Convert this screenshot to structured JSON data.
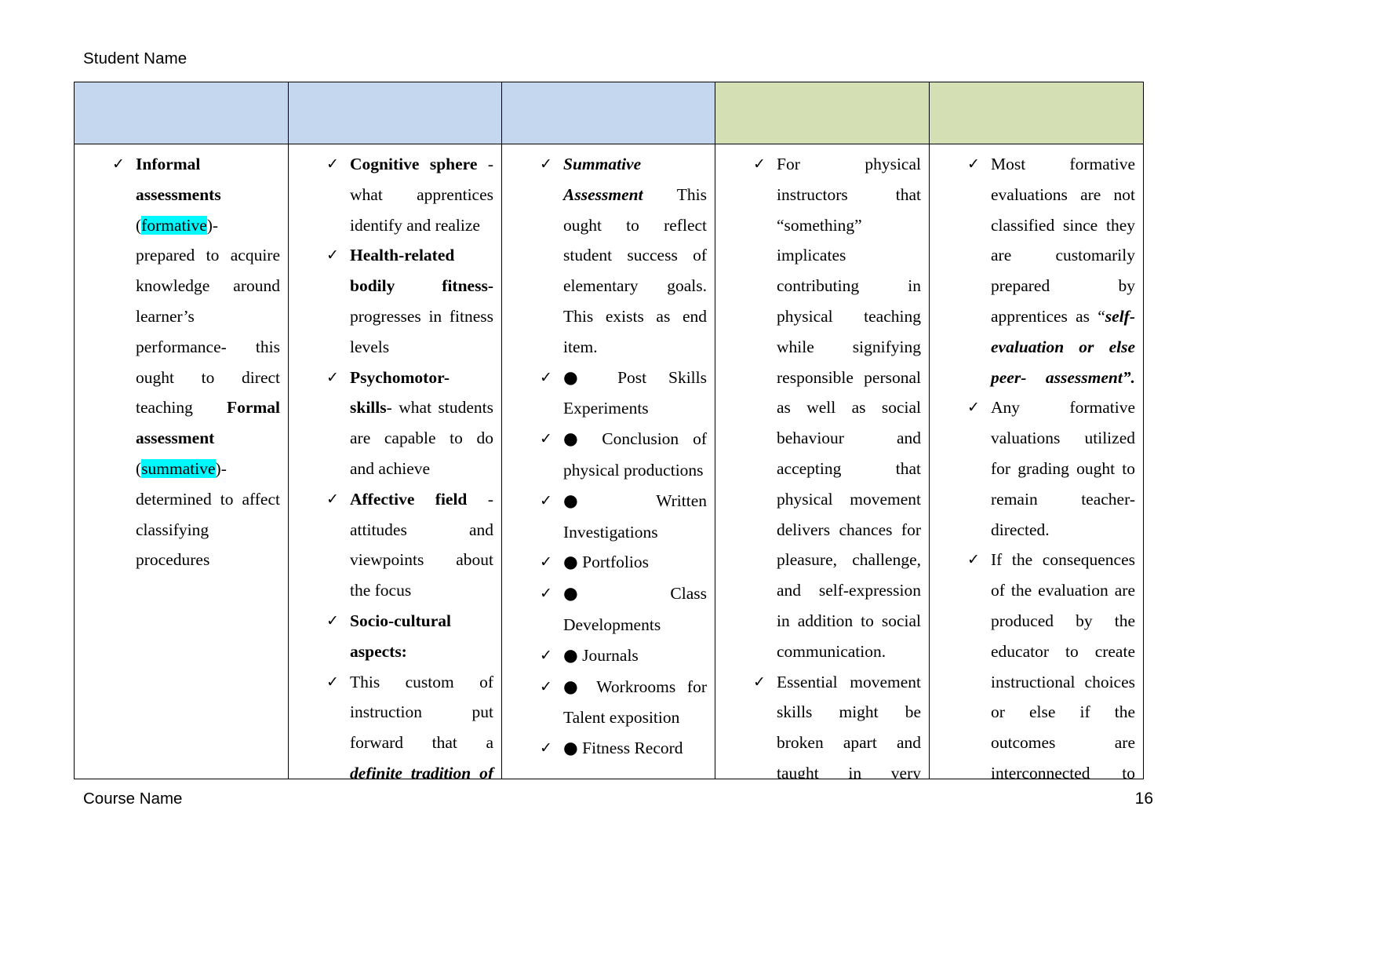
{
  "document": {
    "header_text": "Student Name",
    "footer_text": "Course Name",
    "page_number": "16"
  },
  "colors": {
    "header_blue": "#c5d7ef",
    "header_green": "#d4dfb4",
    "highlight_cyan": "#00f9ff",
    "border": "#000000"
  },
  "table": {
    "headers": [
      {
        "label": "",
        "fill": "#c5d7ef"
      },
      {
        "label": "",
        "fill": "#c5d7ef"
      },
      {
        "label": "",
        "fill": "#c5d7ef"
      },
      {
        "label": "",
        "fill": "#d4dfb4"
      },
      {
        "label": "",
        "fill": "#d4dfb4"
      }
    ],
    "columns": [
      {
        "id": "column-1",
        "items": [
          "Informal assessments (formative)- prepared to acquire knowledge around learner’s performance- this ought to direct teaching Formal assessment (summative)- determined to affect classifying procedures"
        ]
      },
      {
        "id": "column-2",
        "items": [
          "Cognitive sphere - what apprentices identify and realize",
          "Health-related bodily fitness- progresses in fitness levels",
          "Psychomotor- skills- what students are capable to do and achieve",
          "Affective field - attitudes and viewpoints about the focus",
          "Socio-cultural aspects:",
          "This custom of instruction put forward that a definite tradition of"
        ]
      },
      {
        "id": "column-3",
        "items": [
          "Summative Assessment This ought to reflect student success of elementary goals. This exists as end item.",
          "● Post Skills Experiments",
          "● Conclusion of physical productions",
          "● Written Investigations",
          "● Portfolios",
          "● Class Developments",
          "● Journals",
          "● Workrooms for Talent exposition",
          "● Fitness Record"
        ]
      },
      {
        "id": "column-4",
        "items": [
          "For physical instructors that “something” implicates contributing in physical teaching while signifying responsible personal as well as social behaviour and accepting that physical movement delivers chances for pleasure, challenge, and self-expression in addition to social communication.",
          "Essential movement skills might be broken apart and taught in very"
        ]
      },
      {
        "id": "column-5",
        "items": [
          "Most formative evaluations are not classified since they are customarily prepared by apprentices as “self-evaluation or else peer- assessment”.",
          "Any formative valuations utilized for grading ought to remain teacher-directed.",
          "If the consequences of the evaluation are produced by the educator to create instructional choices or else if the outcomes are interconnected to"
        ]
      }
    ]
  }
}
